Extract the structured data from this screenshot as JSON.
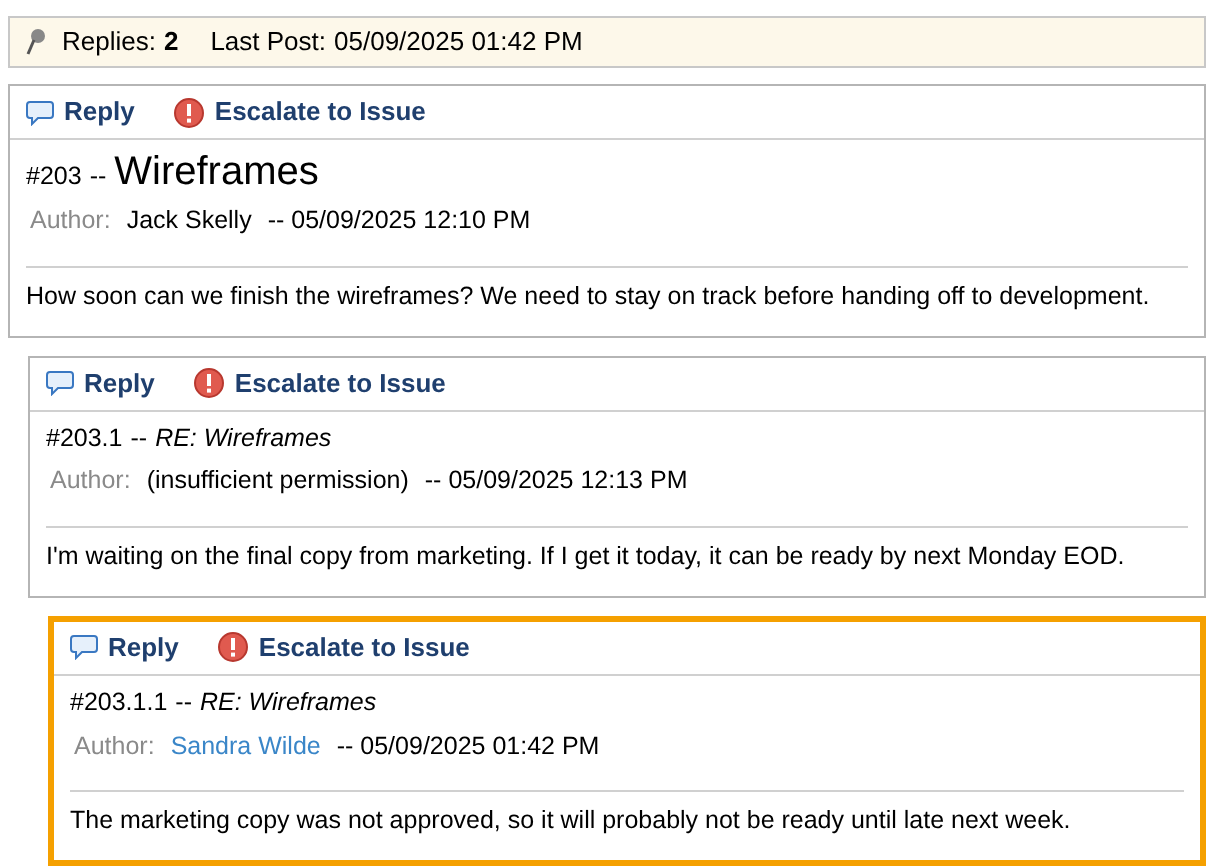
{
  "summary": {
    "replies_label": "Replies:",
    "replies_count": "2",
    "last_post_label": "Last Post:",
    "last_post": "05/09/2025 01:42 PM"
  },
  "posts": [
    {
      "kind": "topic",
      "number": "#203",
      "separator": "--",
      "title": "Wireframes",
      "author_label": "Author:",
      "author": "Jack Skelly",
      "author_link": false,
      "date": "-- 05/09/2025 12:10 PM",
      "body": "How soon can we finish the wireframes? We need to stay on track before handing off to development.",
      "highlighted": false,
      "actions": [
        "Reply",
        "Escalate to Issue"
      ],
      "children": [
        {
          "kind": "reply",
          "number": "#203.1",
          "separator": "--",
          "title": "RE: Wireframes",
          "author_label": "Author:",
          "author": "(insufficient permission)",
          "author_link": false,
          "date": "-- 05/09/2025 12:13 PM",
          "body": "I'm waiting on the final copy from marketing. If I get it today, it can be ready by next Monday EOD.",
          "highlighted": false,
          "actions": [
            "Reply",
            "Escalate to Issue"
          ],
          "children": [
            {
              "kind": "reply",
              "number": "#203.1.1",
              "separator": "--",
              "title": "RE: Wireframes",
              "author_label": "Author:",
              "author": "Sandra Wilde",
              "author_link": true,
              "date": "-- 05/09/2025 01:42 PM",
              "body": "The marketing copy was not approved, so it will probably not be ready until late next week.",
              "highlighted": true,
              "actions": [
                "Reply",
                "Escalate to Issue"
              ]
            }
          ]
        }
      ]
    }
  ]
}
